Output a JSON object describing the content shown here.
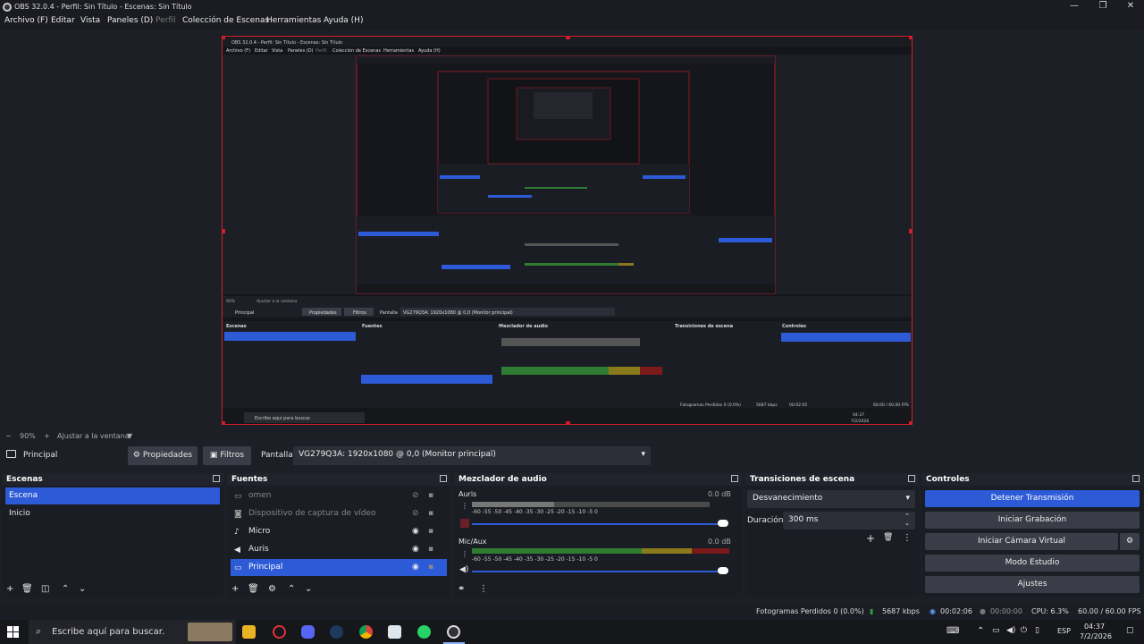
{
  "window": {
    "title": "OBS 32.0.4 - Perfil: Sin Título - Escenas: Sin Título",
    "min": "—",
    "max": "❐",
    "close": "✕"
  },
  "menu": [
    "Archivo (F)",
    "Editar",
    "Vista",
    "Paneles (D)",
    "Perfil",
    "Colección de Escenas",
    "Herramientas",
    "Ayuda (H)"
  ],
  "zoom": {
    "value": "90%",
    "fit": "Ajustar a la ventana",
    "minus": "−",
    "plus": "+"
  },
  "source_bar": {
    "selected_source": "Principal",
    "properties": "Propiedades",
    "filters": "Filtros",
    "display_label": "Pantalla",
    "display_value": "VG279Q3A: 1920x1080 @ 0,0 (Monitor principal)"
  },
  "scenes": {
    "title": "Escenas",
    "items": [
      "Escena",
      "Inicio"
    ],
    "selected": 0
  },
  "sources": {
    "title": "Fuentes",
    "items": [
      {
        "name": "omen",
        "visible": false
      },
      {
        "name": "Dispositivo de captura de vídeo",
        "visible": false
      },
      {
        "name": "Micro",
        "visible": true
      },
      {
        "name": "Auris",
        "visible": true
      },
      {
        "name": "Principal",
        "visible": true
      }
    ],
    "selected": 4
  },
  "mixer": {
    "title": "Mezclador de audio",
    "channels": [
      {
        "name": "Auris",
        "db": "0.0 dB",
        "volume": 1.0
      },
      {
        "name": "Mic/Aux",
        "db": "0.0 dB",
        "volume": 1.0
      }
    ],
    "ticks": [
      "-60",
      "-55",
      "-50",
      "-45",
      "-40",
      "-35",
      "-30",
      "-25",
      "-20",
      "-15",
      "-10",
      "-5",
      "0"
    ]
  },
  "transitions": {
    "title": "Transiciones de escena",
    "type": "Desvanecimiento",
    "duration_label": "Duración",
    "duration": "300 ms"
  },
  "controls": {
    "title": "Controles",
    "buttons": [
      "Detener Transmisión",
      "Iniciar Grabación",
      "Iniciar Cámara Virtual",
      "Modo Estudio",
      "Ajustes"
    ]
  },
  "status": {
    "dropped": "Fotogramas Perdidos 0 (0.0%)",
    "bitrate": "5687 kbps",
    "stream_time": "00:02:06",
    "rec_time": "00:00:00",
    "cpu": "CPU: 6.3%",
    "fps": "60.00 / 60.00 FPS"
  },
  "taskbar": {
    "search": "Escribe aquí para buscar.",
    "lang": "ESP",
    "time": "04:37",
    "date": "7/2/2026"
  },
  "nested": {
    "title": "OBS 32.0.4 - Perfil: Sin Título - Escenas: Sin Título",
    "menu": [
      "Archivo (F)",
      "Editar",
      "Vista",
      "Paneles (D)",
      "Perfil",
      "Colección de Escenas",
      "Herramientas",
      "Ayuda (H)"
    ],
    "zoom": "90%",
    "fit": "Ajustar a la ventana",
    "source": "Principal",
    "properties": "Propiedades",
    "filters": "Filtros",
    "display_label": "Pantalla",
    "display_value": "VG279Q3A: 1920x1080 @ 0,0 (Monitor principal)",
    "scenes_title": "Escenas",
    "sources_title": "Fuentes",
    "mixer_title": "Mezclador de audio",
    "transitions_title": "Transiciones de escena",
    "controls_title": "Controles",
    "search": "Escribe aquí para buscar.",
    "status": "Fotogramas Perdidos 0 (0.0%)",
    "kbps": "5687 kbps",
    "time": "00:02:05",
    "fps": "60.00 / 60.00 FPS",
    "clock": "04:37",
    "date": "7/2/2026"
  },
  "colors": {
    "accent": "#2d5bd7",
    "border": "#d01f2a",
    "meter_green": "#2e7d32",
    "meter_yellow": "#8a7a1c",
    "meter_red": "#7a1a1a"
  }
}
